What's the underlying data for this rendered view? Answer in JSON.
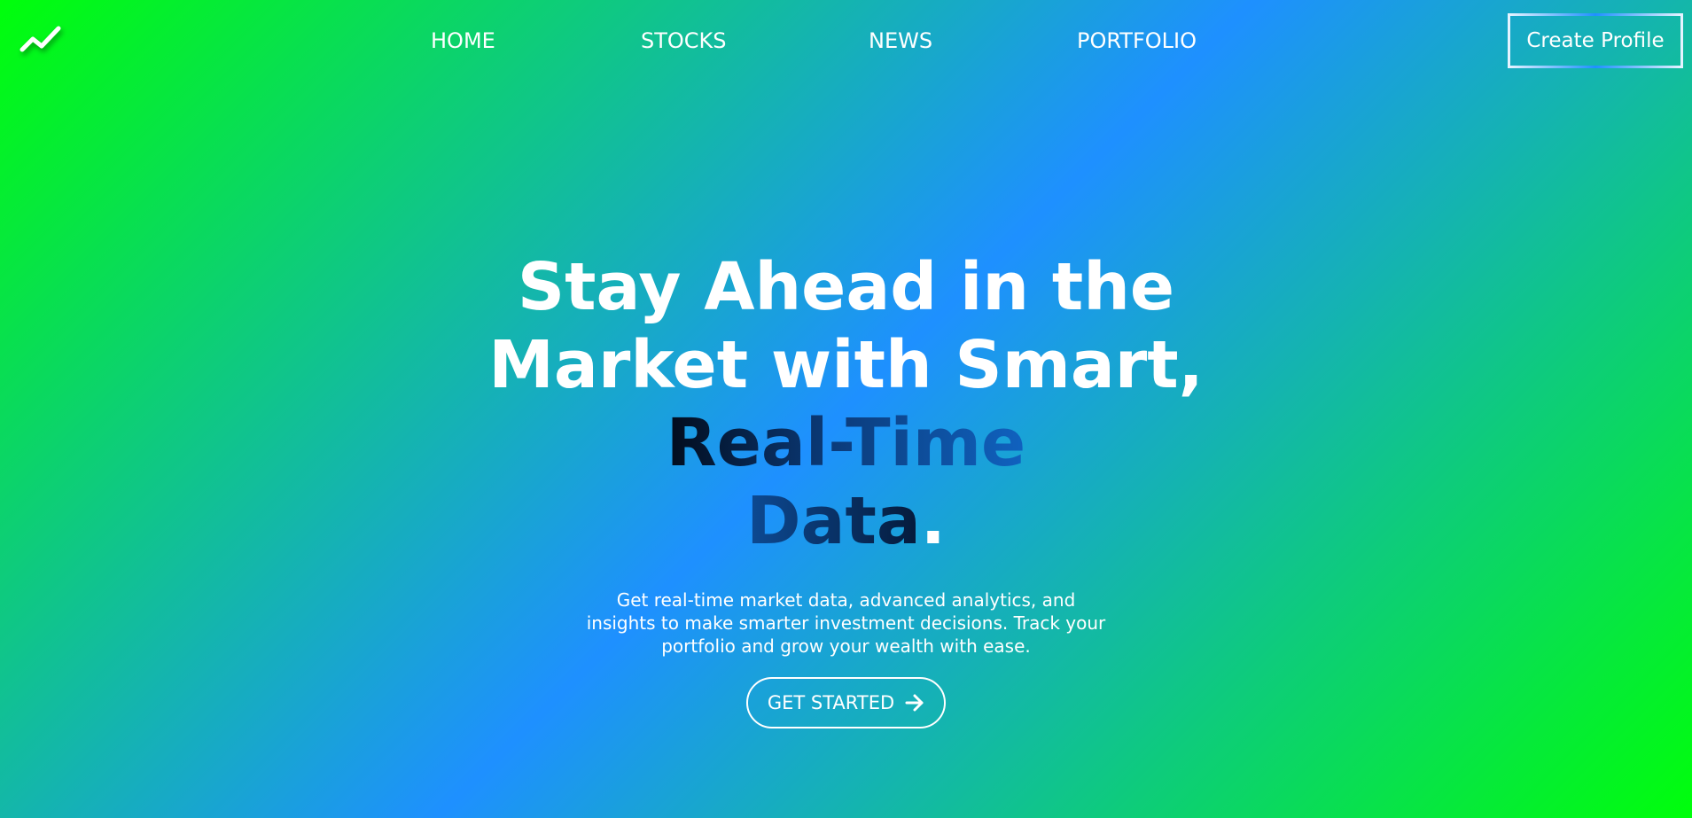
{
  "brand": {
    "logo_icon": "trend-up-icon"
  },
  "nav": {
    "items": [
      {
        "label": "HOME"
      },
      {
        "label": "STOCKS"
      },
      {
        "label": "NEWS"
      },
      {
        "label": "PORTFOLIO"
      }
    ]
  },
  "header": {
    "create_profile_label": "Create Profile"
  },
  "hero": {
    "headline_part1": "Stay Ahead in the Market with Smart, ",
    "headline_accent": "Real-Time",
    "headline_accent2": "Data",
    "headline_end": ".",
    "subtitle": "Get real-time market data, advanced analytics, and insights to make smarter investment decisions. Track your portfolio and grow your wealth with ease.",
    "cta_label": "GET STARTED",
    "cta_icon": "arrow-right-icon"
  },
  "colors": {
    "gradient_green": "#00ff0a",
    "gradient_blue": "#1e90ff",
    "accent_dark": "#020c1c"
  }
}
